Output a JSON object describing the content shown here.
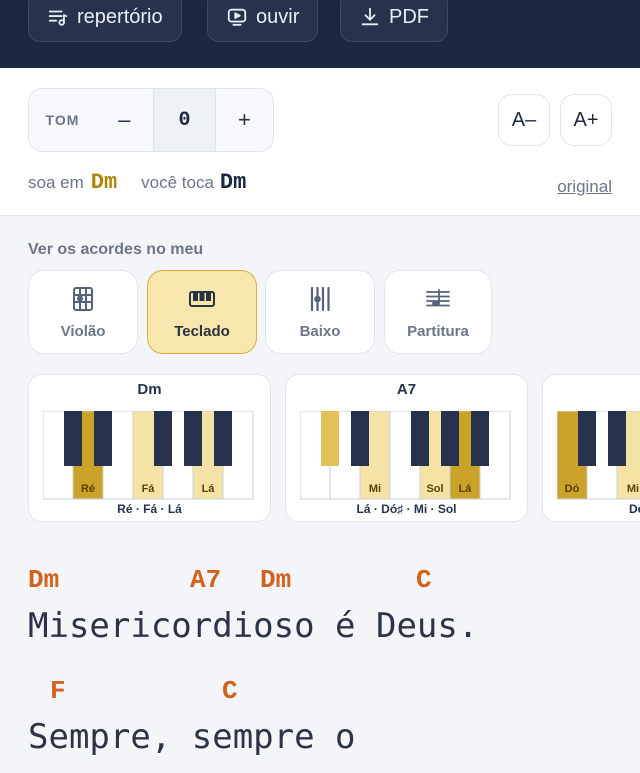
{
  "topbar": {
    "buttons": [
      {
        "label": "repertório",
        "icon": "list-music-icon"
      },
      {
        "label": "ouvir",
        "icon": "play-screen-icon"
      },
      {
        "label": "PDF",
        "icon": "download-icon"
      }
    ]
  },
  "tone": {
    "label": "TOM",
    "minus": "–",
    "value": "0",
    "plus": "+",
    "font_smaller": "A–",
    "font_larger": "A+",
    "sounds_label": "soa em",
    "sounds_key": "Dm",
    "play_label": "você toca",
    "play_key": "Dm",
    "original_link": "original"
  },
  "instruments": {
    "title": "Ver os acordes no meu",
    "items": [
      {
        "label": "Violão",
        "icon": "guitar-grid-icon"
      },
      {
        "label": "Teclado",
        "icon": "keyboard-icon",
        "active": true
      },
      {
        "label": "Baixo",
        "icon": "bass-strings-icon"
      },
      {
        "label": "Partitura",
        "icon": "staff-icon"
      }
    ]
  },
  "chords": [
    {
      "name": "Dm",
      "notes": "Ré · Fá · Lá",
      "labels": [
        "Ré",
        "Fá",
        "Lá"
      ]
    },
    {
      "name": "A7",
      "notes": "Lá · Dó♯ · Mi · Sol",
      "labels": [
        "Mi",
        "Sol",
        "Lá"
      ]
    },
    {
      "name": "",
      "notes": "Dó",
      "labels": [
        "Dó",
        "Mi"
      ]
    }
  ],
  "lyrics": {
    "line1_chords": [
      "Dm",
      "A7",
      "Dm",
      "C"
    ],
    "line1_text": "Misericordioso é Deus.",
    "line2_chords": [
      "F",
      "C"
    ],
    "line2_text": "Sempre, sempre o"
  },
  "colors": {
    "topbar": "#1c2740",
    "accent_gold": "#b0860b",
    "chord_orange": "#d2621c",
    "active_bg": "#f8e7ac"
  }
}
